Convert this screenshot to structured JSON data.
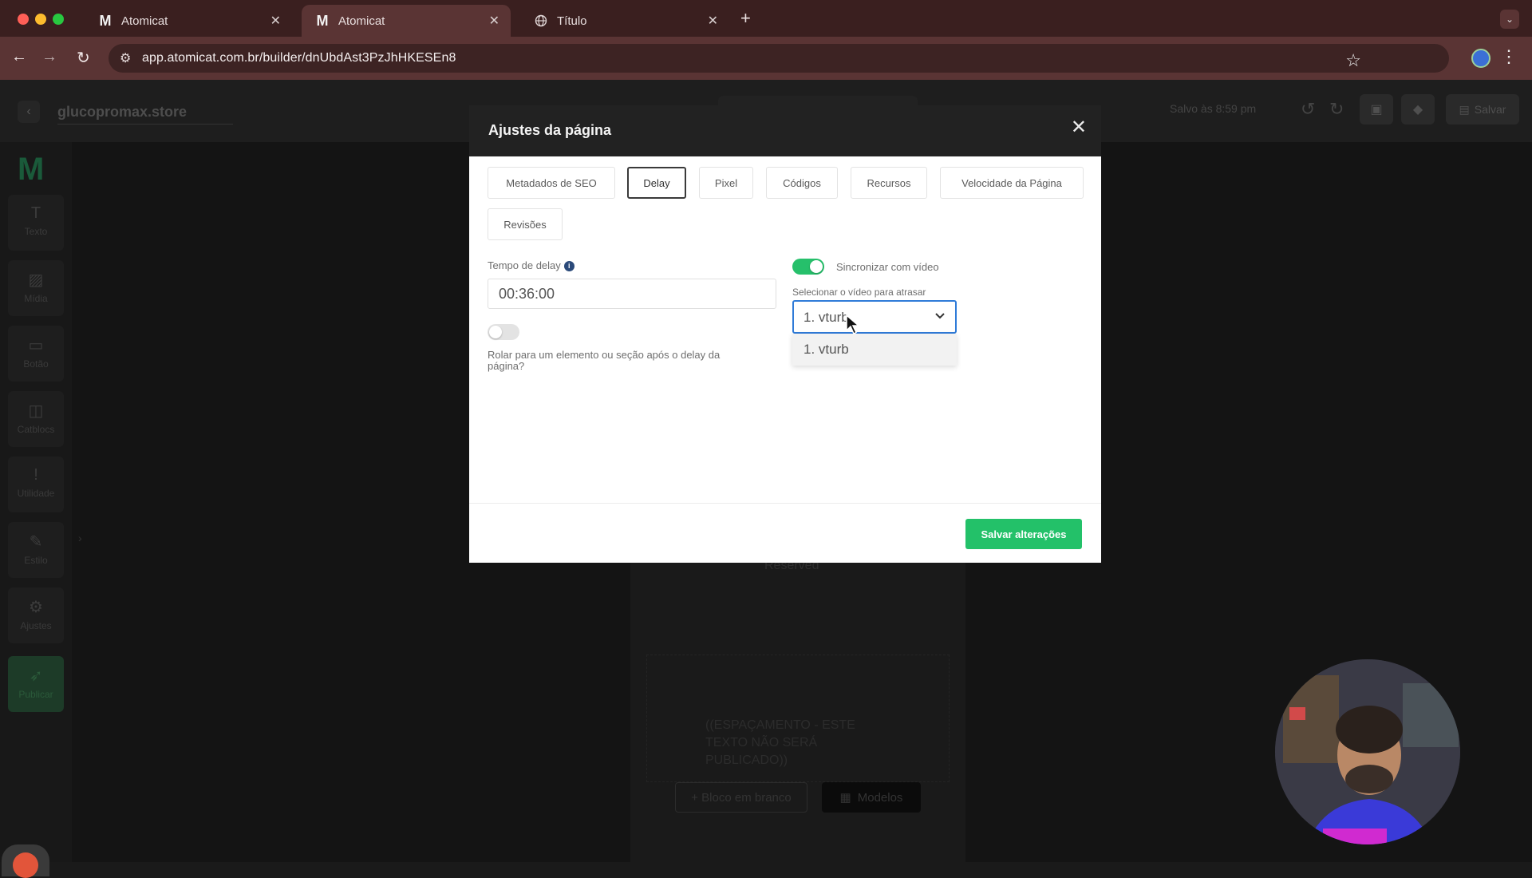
{
  "browser": {
    "tabs": [
      {
        "title": "Atomicat",
        "favicon": "M"
      },
      {
        "title": "Atomicat",
        "favicon": "M"
      },
      {
        "title": "Título",
        "favicon": "globe-icon"
      }
    ],
    "url": "app.atomicat.com.br/builder/dnUbdAst3PzJhHKESEn8"
  },
  "app": {
    "site_name": "glucopromax.store",
    "saved_status": "Salvo às 8:59 pm",
    "save_label": "Salvar",
    "sidebar": [
      {
        "label": "Texto"
      },
      {
        "label": "Mídia"
      },
      {
        "label": "Botão"
      },
      {
        "label": "Catblocs"
      },
      {
        "label": "Utilidade"
      },
      {
        "label": "Estilo"
      },
      {
        "label": "Ajustes"
      },
      {
        "label": "Publicar"
      }
    ],
    "canvas": {
      "reserved_text": "Reserved",
      "spacer_text": "((ESPAÇAMENTO - ESTE TEXTO NÃO SERÁ PUBLICADO))",
      "blank_block_label": "+ Bloco em branco",
      "models_label": "Modelos"
    }
  },
  "modal": {
    "title": "Ajustes da página",
    "tabs": [
      {
        "label": "Metadados de SEO"
      },
      {
        "label": "Delay"
      },
      {
        "label": "Pixel"
      },
      {
        "label": "Códigos"
      },
      {
        "label": "Recursos"
      },
      {
        "label": "Velocidade da Página"
      },
      {
        "label": "Revisões"
      }
    ],
    "active_tab": "Delay",
    "delay_label": "Tempo de delay",
    "delay_value": "00:36:00",
    "scroll_toggle_on": false,
    "scroll_label": "Rolar para um elemento ou seção após o delay da página?",
    "sync_toggle_on": true,
    "sync_label": "Sincronizar com vídeo",
    "video_select_label": "Selecionar o vídeo para atrasar",
    "video_selected": "1. vturb",
    "video_options": [
      "1. vturb"
    ],
    "save_button": "Salvar alterações"
  },
  "colors": {
    "accent_green": "#23c169",
    "select_focus": "#2f7bd8",
    "modal_header": "#222222"
  }
}
